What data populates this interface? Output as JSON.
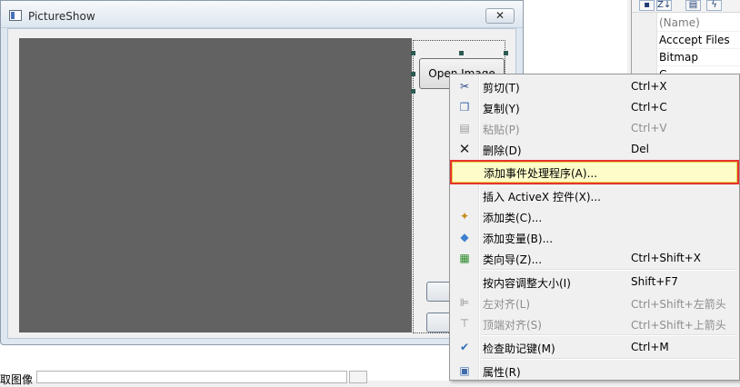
{
  "dialog": {
    "title": "PictureShow",
    "close_glyph": "✕",
    "open_button_label": "Open Image"
  },
  "bottom": {
    "label_fragment": "取图像"
  },
  "properties": {
    "toolbar_sort_glyph": "Z↓",
    "rows": [
      "(Name)",
      "Acccept Files",
      "Bitmap",
      "C..."
    ]
  },
  "menu": {
    "items": [
      {
        "label": "剪切(T)",
        "shortcut": "Ctrl+X",
        "icon": "scissors-icon",
        "glyph": "✂",
        "enabled": true
      },
      {
        "label": "复制(Y)",
        "shortcut": "Ctrl+C",
        "icon": "copy-icon",
        "glyph": "❐",
        "enabled": true
      },
      {
        "label": "粘贴(P)",
        "shortcut": "Ctrl+V",
        "icon": "paste-icon",
        "glyph": "▤",
        "enabled": false
      },
      {
        "label": "删除(D)",
        "shortcut": "Del",
        "icon": "delete-icon",
        "glyph": "✕",
        "enabled": true
      },
      {
        "label": "添加事件处理程序(A)...",
        "shortcut": "",
        "icon": "",
        "glyph": "",
        "enabled": true,
        "highlighted": true
      },
      {
        "label": "插入 ActiveX 控件(X)...",
        "shortcut": "",
        "icon": "",
        "glyph": "",
        "enabled": true
      },
      {
        "label": "添加类(C)...",
        "shortcut": "",
        "icon": "add-class-icon",
        "glyph": "✦",
        "enabled": true
      },
      {
        "label": "添加变量(B)...",
        "shortcut": "",
        "icon": "add-variable-icon",
        "glyph": "◆",
        "enabled": true
      },
      {
        "label": "类向导(Z)...",
        "shortcut": "Ctrl+Shift+X",
        "icon": "class-wizard-icon",
        "glyph": "▦",
        "enabled": true
      },
      {
        "label": "按内容调整大小(I)",
        "shortcut": "Shift+F7",
        "icon": "",
        "glyph": "",
        "enabled": true
      },
      {
        "label": "左对齐(L)",
        "shortcut": "Ctrl+Shift+左箭头",
        "icon": "align-left-icon",
        "glyph": "⊫",
        "enabled": false
      },
      {
        "label": "顶端对齐(S)",
        "shortcut": "Ctrl+Shift+上箭头",
        "icon": "align-top-icon",
        "glyph": "⊤",
        "enabled": false
      },
      {
        "label": "检查助记键(M)",
        "shortcut": "Ctrl+M",
        "icon": "check-mnemonics-icon",
        "glyph": "✔",
        "enabled": true
      },
      {
        "label": "属性(R)",
        "shortcut": "",
        "icon": "properties-icon",
        "glyph": "▣",
        "enabled": true
      }
    ]
  }
}
